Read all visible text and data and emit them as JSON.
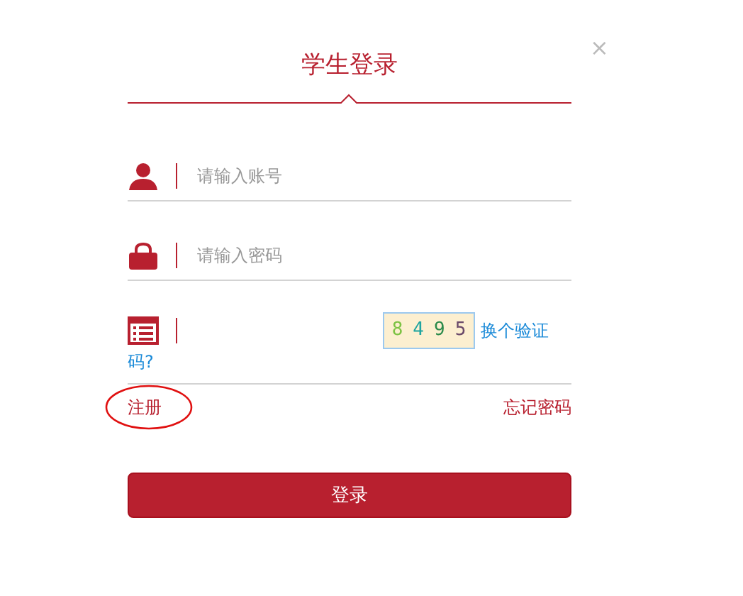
{
  "title": "学生登录",
  "close": "×",
  "fields": [
    {
      "kind": "user",
      "placeholder": "请输入账号"
    },
    {
      "kind": "password",
      "placeholder": "请输入密码"
    }
  ],
  "captcha": {
    "digits": [
      {
        "char": "8",
        "color": "#7cc243"
      },
      {
        "char": "4",
        "color": "#1fa5a0"
      },
      {
        "char": "9",
        "color": "#2a8a4a"
      },
      {
        "char": "5",
        "color": "#6a4a6a"
      }
    ],
    "refresh_link_lines": [
      "换个验证",
      "码?"
    ]
  },
  "register_link": "注册",
  "forgot_link": "忘记密码",
  "login_button": "登录"
}
